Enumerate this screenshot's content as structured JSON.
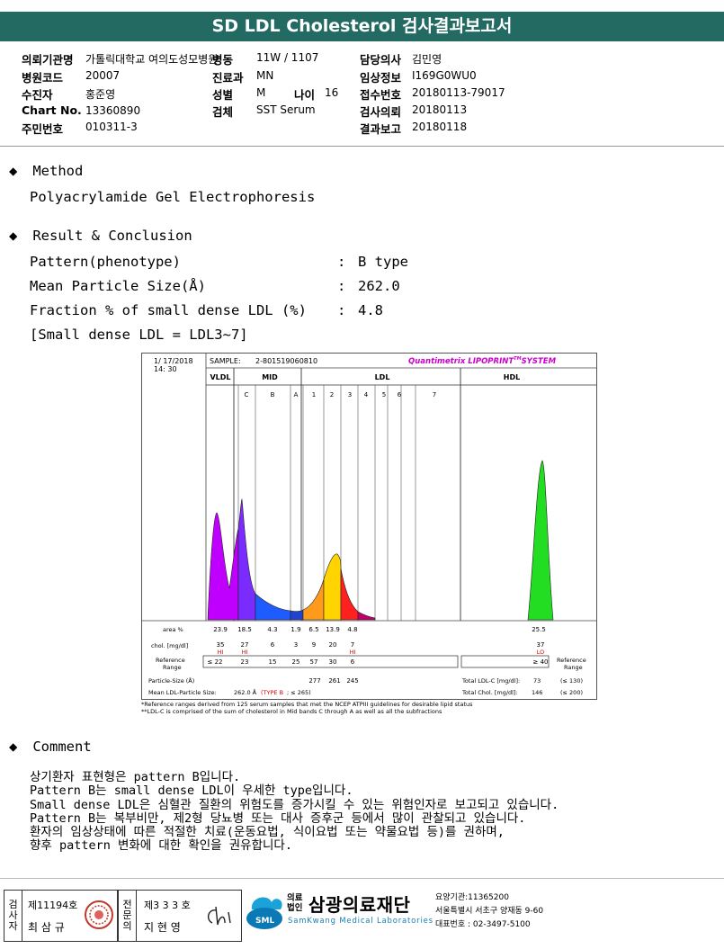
{
  "title": "SD LDL Cholesterol 검사결과보고서",
  "info": {
    "hospital_label": "의뢰기관명",
    "hospital": "가톨릭대학교 여의도성모병원",
    "code_label": "병원코드",
    "code": "20007",
    "patient_label": "수진자",
    "patient": "홍준영",
    "chart_label": "Chart No.",
    "chart": "13360890",
    "id_label": "주민번호",
    "id": "010311-3",
    "ward_label": "병동",
    "ward": "11W / 1107",
    "dept_label": "진료과",
    "dept": "MN",
    "sex_label": "성별",
    "sex": "M",
    "age_label": "나이",
    "age": "16",
    "specimen_label": "검체",
    "specimen": "SST Serum",
    "doctor_label": "담당의사",
    "doctor": "김민영",
    "lab_id_label": "임상정보",
    "lab_id": "I169G0WU0",
    "receipt_label": "접수번호",
    "receipt": "20180113-79017",
    "request_label": "검사의뢰",
    "request": "20180113",
    "report_label": "결과보고",
    "report": "20180118"
  },
  "method": {
    "heading": "Method",
    "text": "Polyacrylamide Gel Electrophoresis"
  },
  "result": {
    "heading": "Result & Conclusion",
    "rows": [
      {
        "label": "Pattern(phenotype)",
        "value": "B type"
      },
      {
        "label": "Mean Particle Size(Å)",
        "value": "262.0"
      },
      {
        "label": "Fraction % of small dense LDL (%)",
        "value": "4.8"
      }
    ],
    "note": "[Small dense LDL = LDL3~7]",
    "colon": ":"
  },
  "chart": {
    "date": "1/ 17/2018",
    "time": "14: 30",
    "sample_label": "SAMPLE:",
    "sample": "2-801519060810",
    "brand": "Quantimetrix LIPOPRINT",
    "brand_tm": "TM",
    "brand_suffix": "SYSTEM",
    "groups": [
      "VLDL",
      "MID",
      "LDL",
      "HDL"
    ],
    "bands": [
      "C",
      "B",
      "A",
      "1",
      "2",
      "3",
      "4",
      "5",
      "6",
      "7"
    ],
    "area_label": "area %",
    "area_values": [
      "23.9",
      "18.5",
      "4.3",
      "1.9",
      "6.5",
      "13.9",
      "4.8",
      "25.5"
    ],
    "chol_label": "chol. [mg/dl]",
    "chol_values": [
      "35",
      "27",
      "6",
      "3",
      "9",
      "20",
      "7",
      "37"
    ],
    "flags": [
      "HI",
      "HI",
      "HI",
      "LO"
    ],
    "ref_label_1": "Reference",
    "ref_label_2": "Range",
    "ref_values": [
      "≤ 22",
      "23",
      "15",
      "25",
      "57",
      "30",
      "6",
      "≥ 40"
    ],
    "ref_right_1": "Reference",
    "ref_right_2": "Range",
    "particle_label": "Particle-Size (Å)",
    "particle_values": [
      "277",
      "261",
      "245"
    ],
    "mean_label": "Mean LDL-Particle Size:",
    "mean_value": "262.0 Å",
    "mean_type": "(TYPE B",
    "mean_ref": "; ≤ 265)",
    "total_ldl_label": "Total LDL-C [mg/dl]:",
    "total_ldl": "73",
    "total_ldl_ref": "(≤ 130)",
    "total_chol_label": "Total Chol. [mg/dl]:",
    "total_chol": "146",
    "total_chol_ref": "(≤ 200)",
    "footnote_1": "*Reference ranges derived from 125 serum samples that met the NCEP ATPIII guidelines for desirable lipid status",
    "footnote_2": "**LDL-C is comprised of the sum of cholesterol in Mid bands C through A as well as all the subfractions"
  },
  "chart_data": {
    "type": "area",
    "title": "",
    "xlabel": "",
    "ylabel": "",
    "categories": [
      "VLDL",
      "C",
      "B",
      "A",
      "1",
      "2",
      "3",
      "4",
      "5",
      "6",
      "7",
      "HDL"
    ],
    "series": [
      {
        "name": "area %",
        "values": [
          23.9,
          18.5,
          4.3,
          1.9,
          6.5,
          13.9,
          4.8,
          null,
          null,
          null,
          null,
          25.5
        ]
      },
      {
        "name": "chol. [mg/dl]",
        "values": [
          35,
          27,
          6,
          3,
          9,
          20,
          7,
          null,
          null,
          null,
          null,
          37
        ]
      }
    ],
    "particle_size": {
      "1": 277,
      "2": 261,
      "3": 245
    }
  },
  "comment": {
    "heading": "Comment",
    "lines": [
      "상기환자 표현형은 pattern B입니다.",
      "Pattern B는 small dense LDL이 우세한 type입니다.",
      "Small dense LDL은 심혈관 질환의 위험도를 증가시킬 수 있는 위험인자로 보고되고 있습니다.",
      "Pattern B는 복부비만, 제2형 당뇨병 또는 대사 증후군 등에서 많이 관찰되고 있습니다.",
      "환자의 임상상태에 따른 적절한 치료(운동요법, 식이요법 또는 약물요법 등)를 권하며,",
      "향후 pattern 변화에 대한 확인을 권유합니다."
    ]
  },
  "footer": {
    "stamp1_hdr": "검사자",
    "stamp1_no": "제11194호",
    "stamp1_name": "최 삼 규",
    "stamp2_hdr": "전문의",
    "stamp2_no": "제3 3 3 호",
    "stamp2_name": "지 현 영",
    "org_prefix_1": "의료",
    "org_prefix_2": "법인",
    "org_name": "삼광의료재단",
    "org_english": "SamKwang Medical Laboratories",
    "logo_text": "SML",
    "org_code": "요양기관:11365200",
    "org_address": "서울특별시 서초구 양재동 9-60",
    "org_phone": "대표번호 : 02-3497-5100"
  },
  "colors": {
    "title_bg": "#236a63",
    "vldl": "#c000ff",
    "mid_c": "#7a2cff",
    "mid_b": "#1f5cff",
    "ldl1": "#ff9900",
    "ldl2": "#ffd400",
    "ldl3": "#ff2222",
    "hdl": "#22dd22",
    "brand": "#cc00cc",
    "flag": "#dd0000"
  }
}
